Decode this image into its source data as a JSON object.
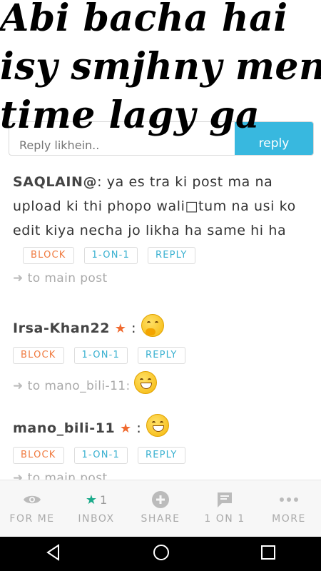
{
  "caption": {
    "line1": "Abi bacha hai",
    "line2": "isy smjhny men",
    "line3": "time lagy ga"
  },
  "reply_bar": {
    "placeholder": "Reply likhein..",
    "button": "reply"
  },
  "posts": [
    {
      "author": "SAQLAIN@",
      "text": ": ya es tra ki post ma na upload ki thi phopo wali□tum na usi ko edit kiya necha jo likha ha same hi ha",
      "actions": {
        "block": "BLOCK",
        "one_on_one": "1-ON-1",
        "reply": "REPLY"
      },
      "nav": "to main post"
    },
    {
      "author": "Irsa-Khan22",
      "star": "★",
      "colon": ":",
      "actions": {
        "block": "BLOCK",
        "one_on_one": "1-ON-1",
        "reply": "REPLY"
      },
      "nav": "to mano_bili-11:"
    },
    {
      "author": "mano_bili-11",
      "star": "★",
      "colon": ":",
      "actions": {
        "block": "BLOCK",
        "one_on_one": "1-ON-1",
        "reply": "REPLY"
      },
      "nav": "to main post"
    }
  ],
  "bottom_nav": {
    "for_me": "FOR ME",
    "inbox": "INBOX",
    "inbox_count": "1",
    "share": "SHARE",
    "one_on_one": "1 ON 1",
    "more": "MORE"
  },
  "colors": {
    "accent": "#38b8df",
    "block": "#f07a3f",
    "star": "#f06a2f",
    "inbox_star": "#1aaa8a"
  }
}
